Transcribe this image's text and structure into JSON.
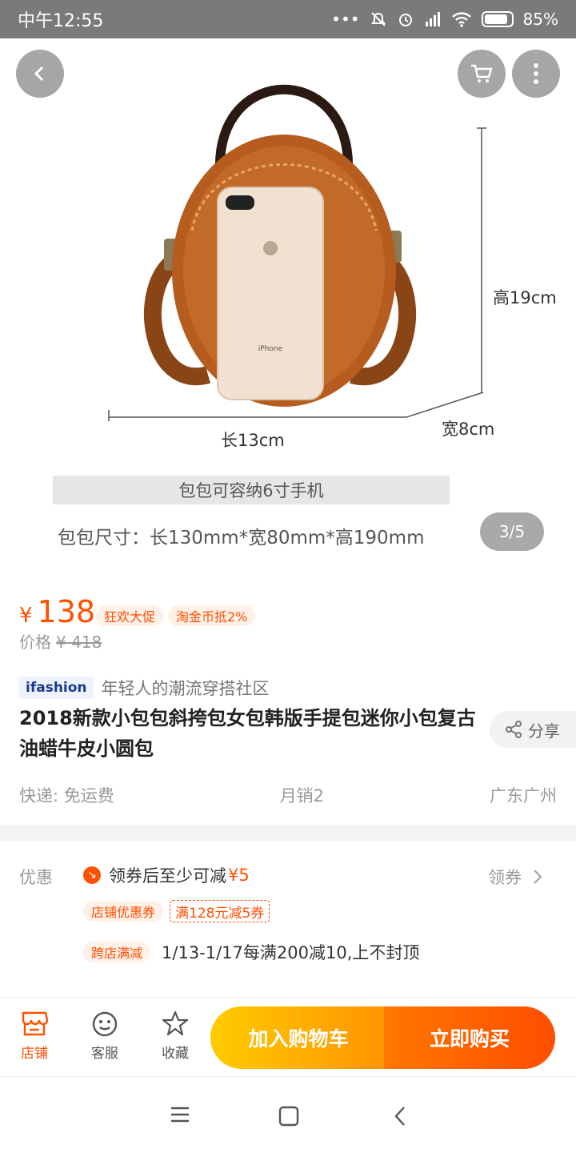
{
  "status_bar": {
    "time": "中午12:55",
    "battery": "85%"
  },
  "gallery": {
    "counter": "3/5",
    "dims": {
      "height": "高19cm",
      "length": "长13cm",
      "width": "宽8cm"
    },
    "phone_label": "iPhone",
    "capacity_caption": "包包可容纳6寸手机",
    "size_caption": "包包尺寸：长130mm*宽80mm*高190mm"
  },
  "price": {
    "currency": "¥",
    "current": "138",
    "tags": [
      "狂欢大促",
      "淘金币抵2%"
    ],
    "original_label": "价格",
    "original": "¥ 418"
  },
  "brand": {
    "logo": "ifashion",
    "slogan": "年轻人的潮流穿搭社区"
  },
  "product": {
    "title": "2018新款小包包斜挎包女包韩版手提包迷你小包复古油蜡牛皮小圆包",
    "share_label": "分享",
    "shipping": "快递: 免运费",
    "monthly_sales": "月销2",
    "location": "广东广州"
  },
  "promotions": {
    "label": "优惠",
    "coupon_text": "领券后至少可减",
    "coupon_amount": "¥5",
    "get_coupon": "领券",
    "shop_coupon_tag": "店铺优惠券",
    "shop_coupon": "满128元减5券",
    "cross_store_tag": "跨店满减",
    "cross_store_text": "1/13-1/17每满200减10,上不封顶"
  },
  "bottom_bar": {
    "shop": "店铺",
    "service": "客服",
    "favorite": "收藏",
    "add_to_cart": "加入购物车",
    "buy_now": "立即购买"
  }
}
